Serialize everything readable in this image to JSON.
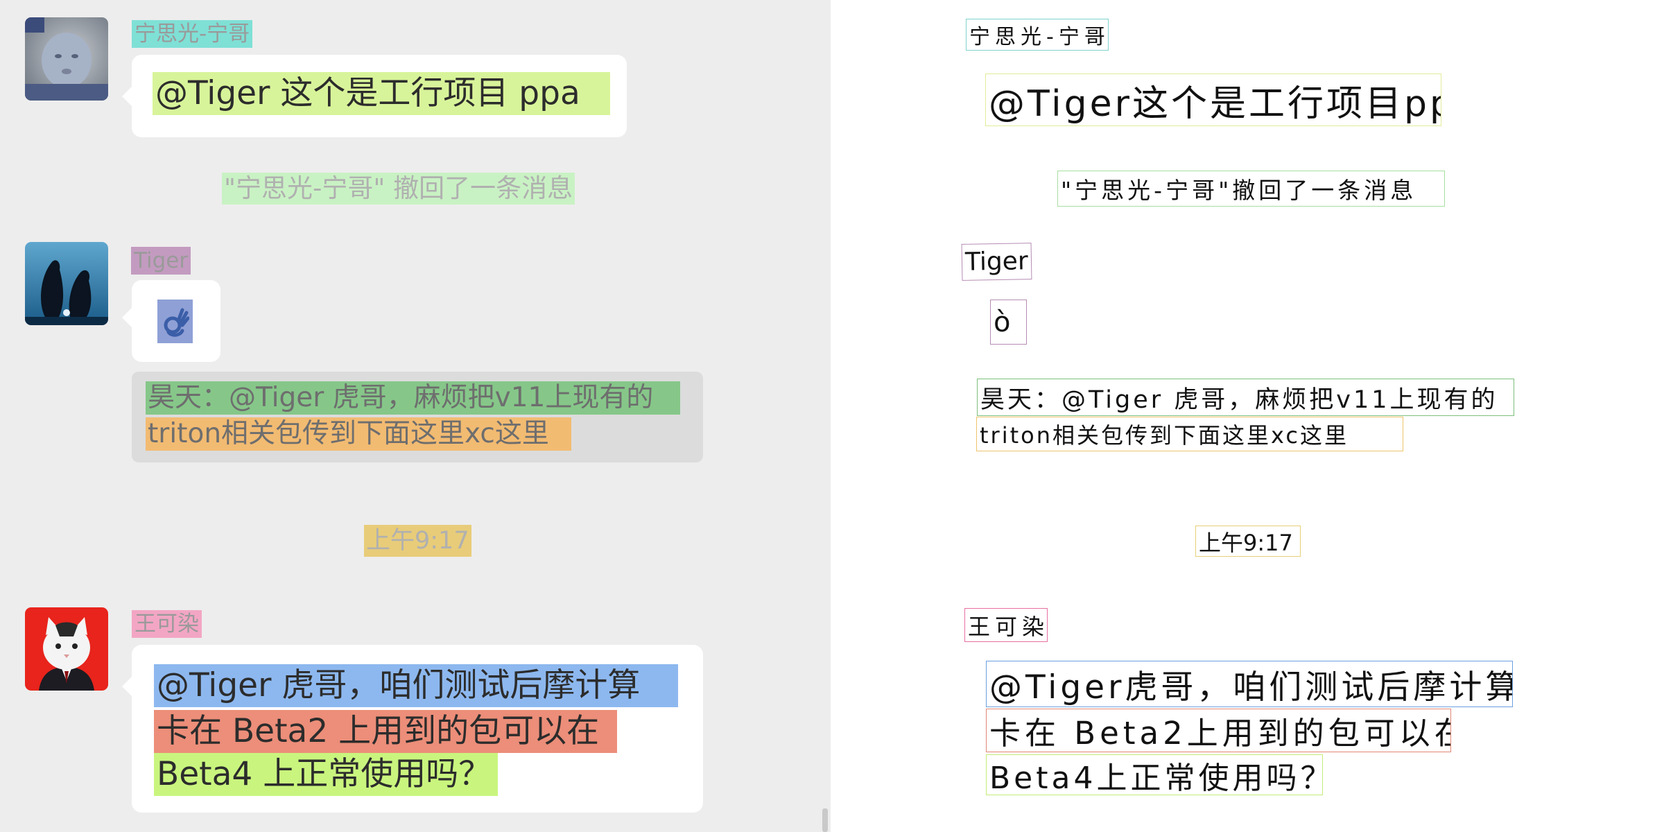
{
  "chat": {
    "messages": [
      {
        "sender": "宁思光-宁哥",
        "avatar": "baby-photo",
        "lines": [
          "@Tiger 这个是工行项目 ppa"
        ]
      },
      {
        "sender": "Tiger",
        "avatar": "penguins-photo",
        "emoji": "👌",
        "quote_lines": [
          "昊天：@Tiger 虎哥，麻烦把v11上现有的",
          "triton相关包传到下面这里xc这里"
        ]
      },
      {
        "sender": "王可染",
        "avatar": "cat-in-suit-photo",
        "lines": [
          "@Tiger 虎哥，咱们测试后摩计算",
          "卡在 Beta2 上用到的包可以在",
          "Beta4 上正常使用吗？"
        ]
      }
    ],
    "recall_notice": "\"宁思光-宁哥\" 撤回了一条消息",
    "timestamp": "上午9:17"
  },
  "ocr": {
    "sender_1": "宁思光-宁哥",
    "message_1": "@Tiger这个是工行项目ppa",
    "recall_notice": "\"宁思光-宁哥\"撤回了一条消息",
    "sender_2": "Tiger",
    "emoji_text": "ò",
    "quote_line_1": "昊天：@Tiger 虎哥，麻烦把v11上现有的",
    "quote_line_2": "triton相关包传到下面这里xc这里",
    "timestamp": "上午9:17",
    "sender_3": "王可染",
    "message_3_line_1": "@Tiger虎哥，咱们测试后摩计算",
    "message_3_line_2": "卡在 Beta2上用到的包可以在",
    "message_3_line_3": "Beta4上正常使用吗？"
  },
  "highlight_colors": {
    "cyan": "#7fe0d6",
    "lime": "#d8f49a",
    "mint": "#c9f2c4",
    "mauve": "#c39bc0",
    "slate": "#8fa0d6",
    "green": "#86c789",
    "orange": "#f2bb72",
    "sand": "#e8cc79",
    "pink": "#f3a6c4",
    "blue": "#8db8ef",
    "salmon": "#ec8e79",
    "yellow_green": "#c9f57e"
  }
}
